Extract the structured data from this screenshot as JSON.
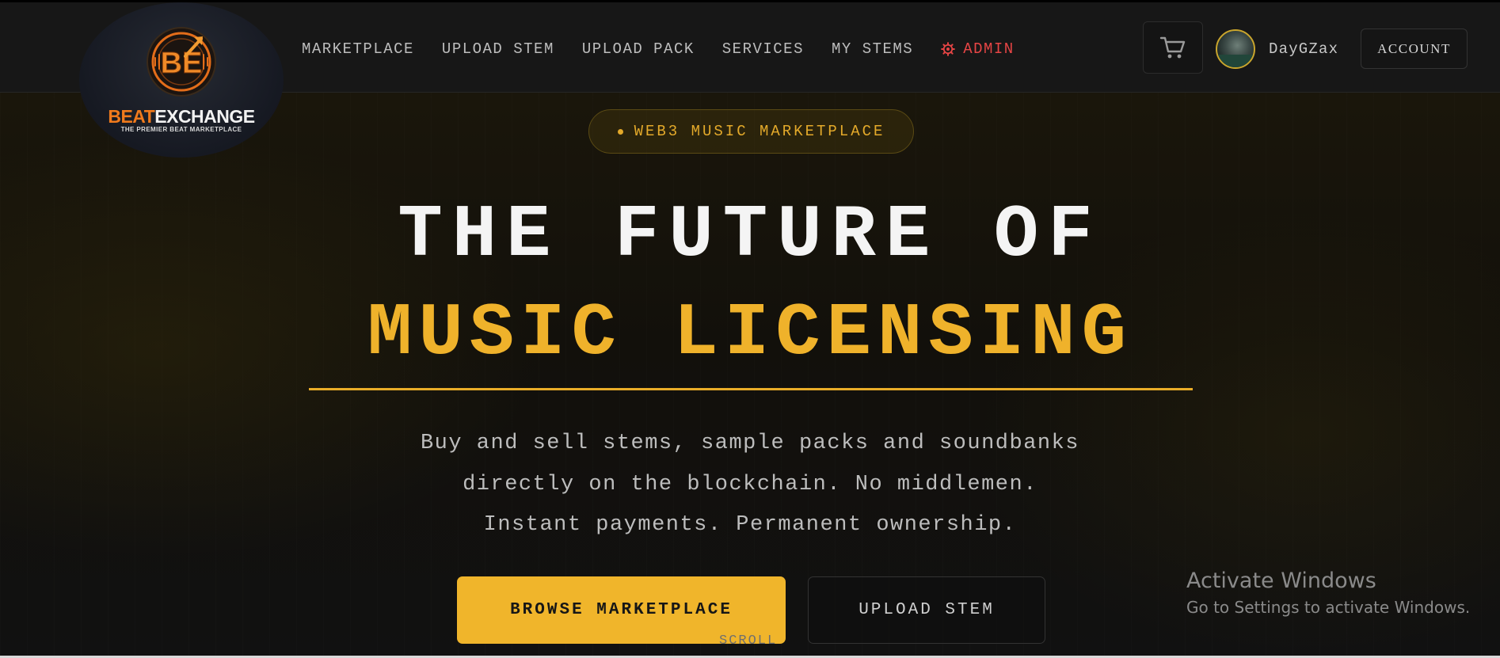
{
  "brand": {
    "name_part1": "BEAT",
    "name_part2": "EXCHANGE",
    "tagline": "THE PREMIER BEAT MARKETPLACE",
    "logo_letters": "BE",
    "accent_color": "#f07a1c"
  },
  "nav": {
    "items": [
      {
        "label": "MARKETPLACE"
      },
      {
        "label": "UPLOAD STEM"
      },
      {
        "label": "UPLOAD PACK"
      },
      {
        "label": "SERVICES"
      },
      {
        "label": "MY STEMS"
      }
    ],
    "admin": {
      "label": "ADMIN",
      "icon": "gear-icon",
      "color": "#e64545"
    }
  },
  "user": {
    "username": "DayGZax",
    "account_label": "ACCOUNT",
    "cart_icon": "cart-icon"
  },
  "hero": {
    "badge": "WEB3 MUSIC MARKETPLACE",
    "headline_line1": "THE FUTURE OF",
    "headline_line2": "MUSIC LICENSING",
    "subtitle_lines": [
      "Buy and sell stems, sample packs and soundbanks",
      "directly on the blockchain. No middlemen.",
      "Instant payments. Permanent ownership."
    ],
    "primary_cta": "BROWSE MARKETPLACE",
    "secondary_cta": "UPLOAD STEM",
    "scroll_hint": "SCROLL",
    "accent_color": "#efb22b"
  },
  "os_watermark": {
    "title": "Activate Windows",
    "subtitle": "Go to Settings to activate Windows."
  }
}
